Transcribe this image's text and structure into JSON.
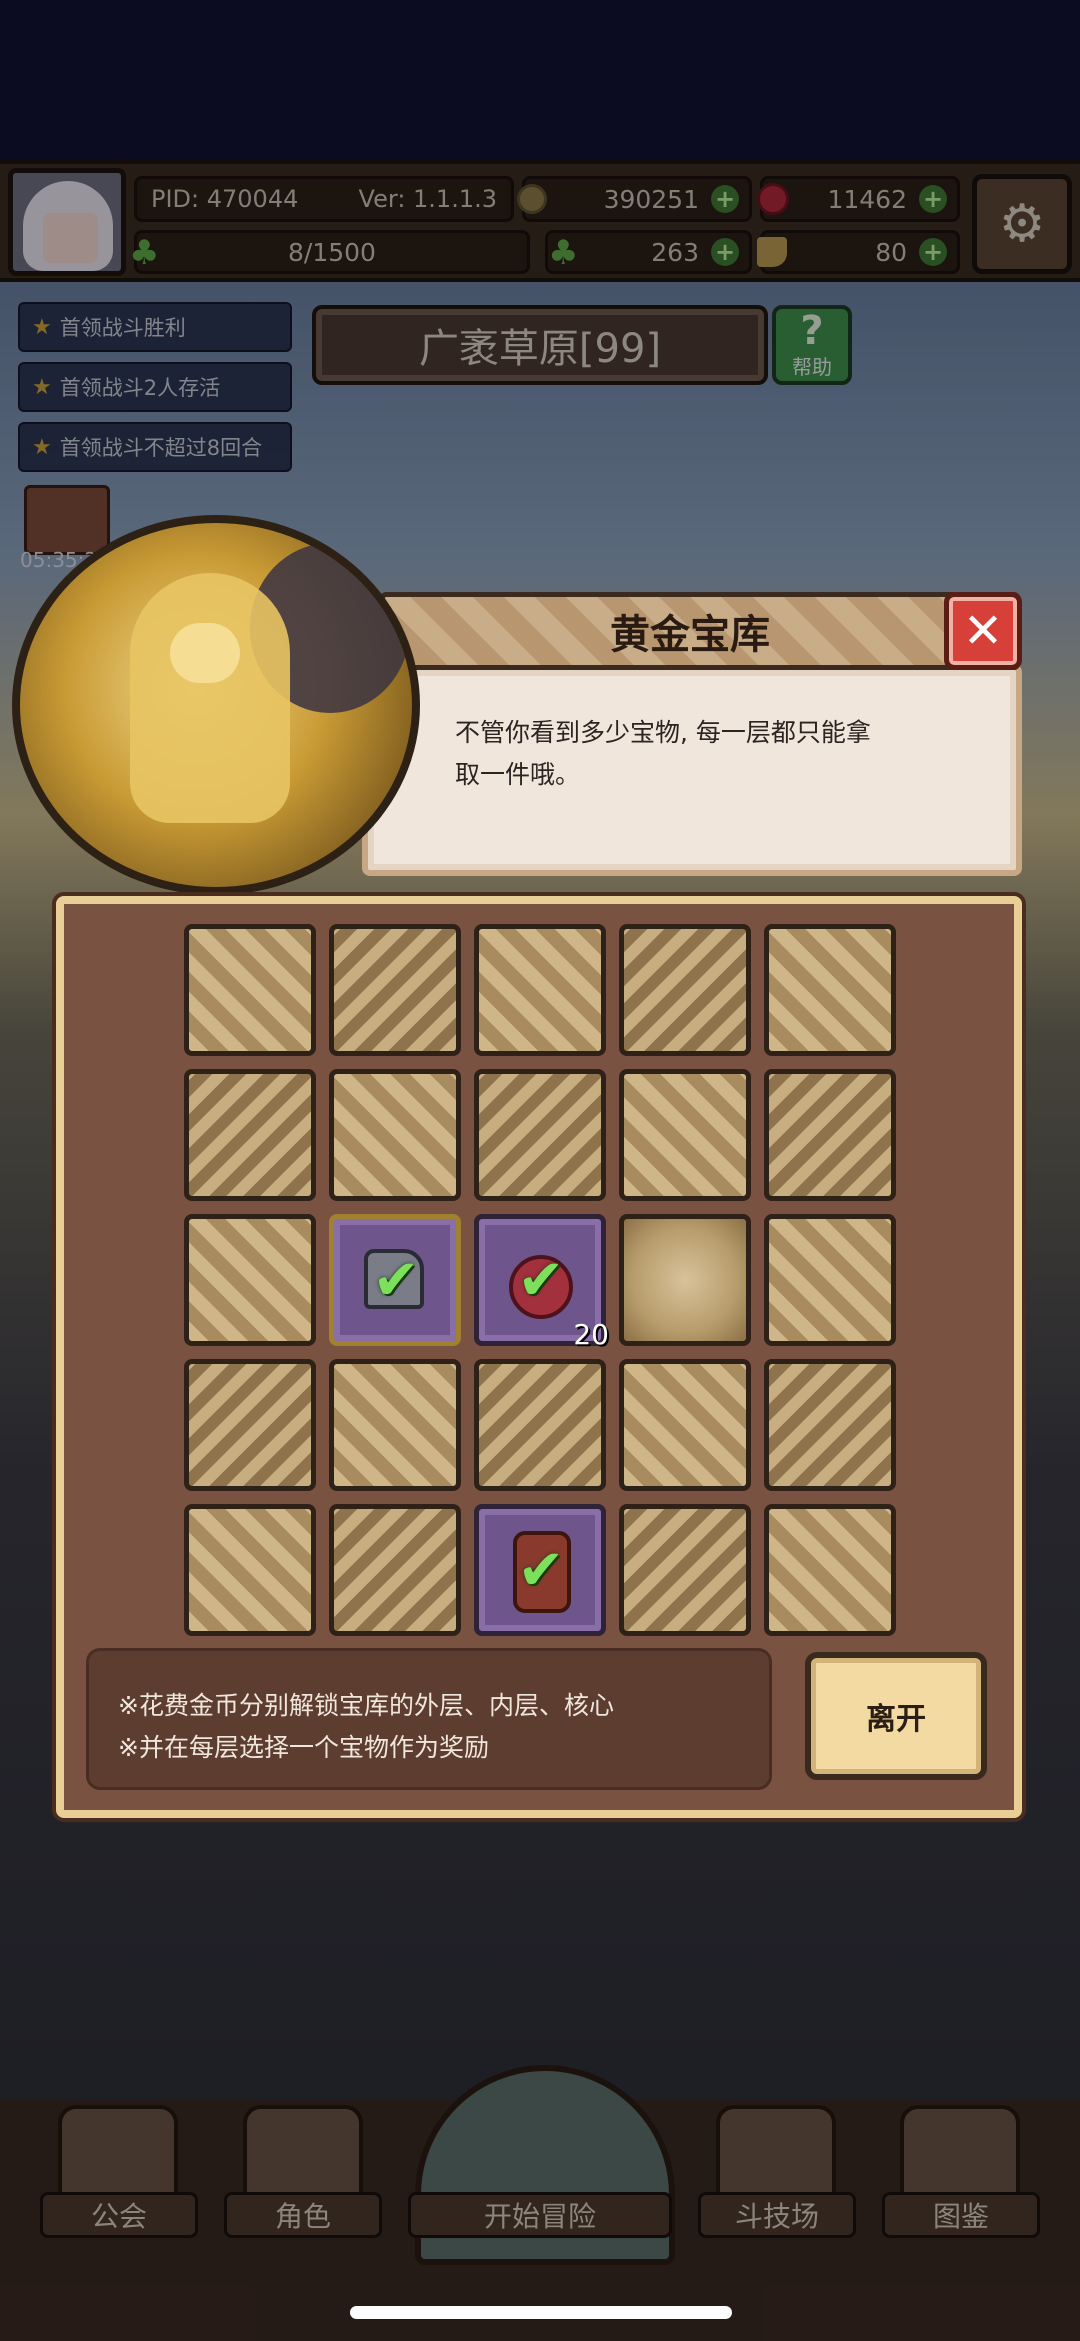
{
  "status_bar": {
    "pid": "PID: 470044",
    "version": "Ver: 1.1.1.3",
    "coins": "390251",
    "rubies": "11462",
    "stamina": "8/1500",
    "clovers": "263",
    "keys": "80"
  },
  "quests": [
    "首领战斗胜利",
    "首领战斗2人存活",
    "首领战斗不超过8回合"
  ],
  "level_title": "广袤草原[99]",
  "help_label": "帮助",
  "chest_timer": "05:35:2",
  "dialog": {
    "title": "黄金宝库",
    "message_line1": "不管你看到多少宝物, 每一层都只能拿",
    "message_line2": "取一件哦。"
  },
  "vault": {
    "grid_rows": 5,
    "grid_cols": 5,
    "claimed_items": [
      {
        "name": "armor-glove",
        "row": 3,
        "col": 2,
        "count": ""
      },
      {
        "name": "red-fruit",
        "row": 3,
        "col": 3,
        "count": "20"
      },
      {
        "name": "red-rune-stone",
        "row": 5,
        "col": 3,
        "count": ""
      }
    ],
    "info_line1": "※花费金币分别解锁宝库的外层、内层、核心",
    "info_line2": "※并在每层选择一个宝物作为奖励",
    "leave_label": "离开"
  },
  "bottom_nav": [
    {
      "label": "公会",
      "icon": "guild-icon"
    },
    {
      "label": "角色",
      "icon": "character-icon"
    },
    {
      "label": "开始冒险",
      "icon": "magnifier-icon"
    },
    {
      "label": "斗技场",
      "icon": "crossed-swords-icon"
    },
    {
      "label": "图鉴",
      "icon": "book-icon"
    }
  ],
  "colors": {
    "accent_green": "#7ce05a",
    "close_red": "#d64038",
    "panel_brown": "#7a5241",
    "item_purple": "#6e558b"
  }
}
